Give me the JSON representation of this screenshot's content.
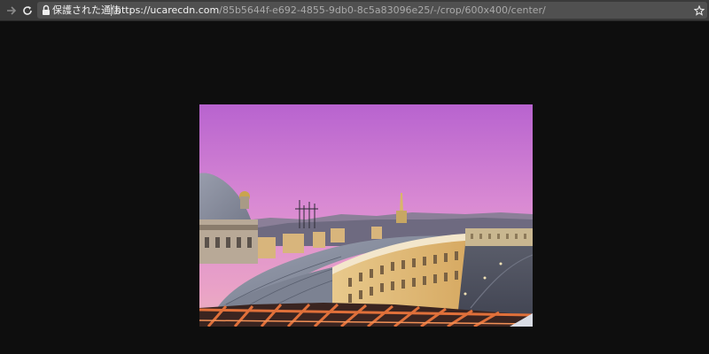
{
  "browser": {
    "security_label": "保護された通信",
    "url_host": "https://ucarecdn.com",
    "url_path": "/85b5644f-e692-4855-9db0-8c5a83096e25/-/crop/600x400/center/",
    "icons": {
      "forward": "arrow-right-icon",
      "reload": "reload-icon",
      "lock": "lock-icon",
      "bookmark": "star-icon"
    }
  },
  "image": {
    "description_colors": {
      "sky_top": "#c26bd0",
      "sky_bottom": "#e9a0c8",
      "page_background": "#0e0e0e"
    }
  }
}
